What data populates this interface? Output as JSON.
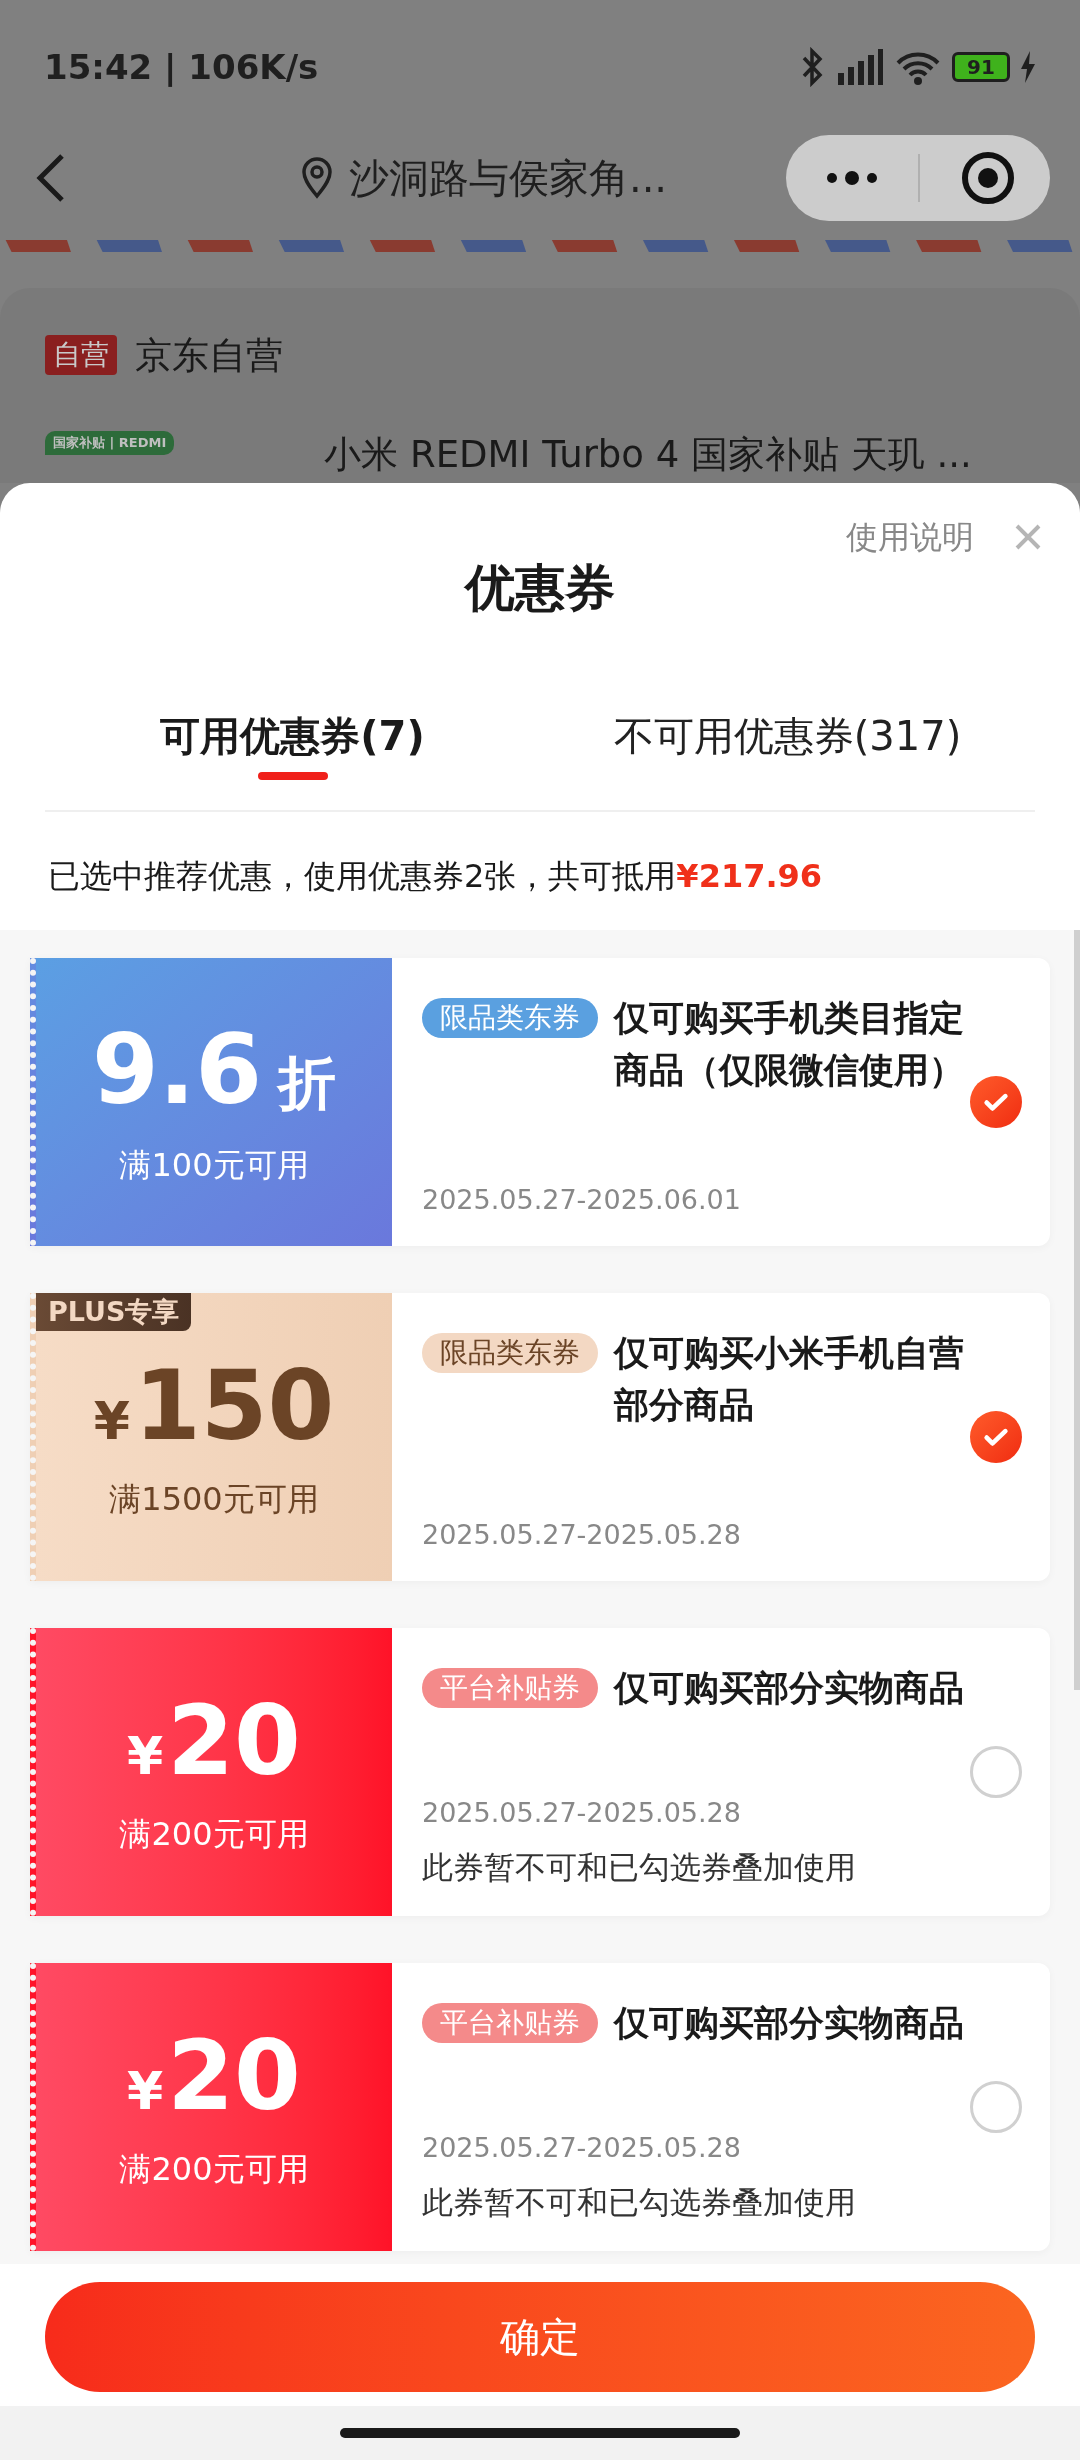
{
  "status_bar": {
    "time": "15:42 | 106K/s",
    "battery": "91"
  },
  "nav": {
    "location": "沙洞路与侯家角..."
  },
  "store": {
    "badge": "自营",
    "name": "京东自营"
  },
  "product": {
    "logo": "国家补贴 | REDMI",
    "title": "小米 REDMI Turbo 4 国家补贴 天玑 ..."
  },
  "sheet": {
    "help": "使用说明",
    "title": "优惠券"
  },
  "tabs": [
    {
      "label": "可用优惠券(7)",
      "selected": true
    },
    {
      "label": "不可用优惠券(317)",
      "selected": false
    }
  ],
  "summary": {
    "text": "已选中推荐优惠，使用优惠券2张，共可抵用",
    "amount": "¥217.96"
  },
  "coupons": [
    {
      "kind": "discount",
      "amount": "9.6",
      "unit": "折",
      "condition": "满100元可用",
      "tag": "限品类东券",
      "title": "仅可购买手机类目指定商品（仅限微信使用）",
      "date": "2025.05.27-2025.06.01",
      "selected": true
    },
    {
      "kind": "plus",
      "badge": "PLUS专享",
      "currency": "¥",
      "amount": "150",
      "condition": "满1500元可用",
      "tag": "限品类东券",
      "title": "仅可购买小米手机自营部分商品",
      "date": "2025.05.27-2025.05.28",
      "selected": true
    },
    {
      "kind": "cash",
      "currency": "¥",
      "amount": "20",
      "condition": "满200元可用",
      "tag": "平台补贴券",
      "title": "仅可购买部分实物商品",
      "date": "2025.05.27-2025.05.28",
      "note": "此券暂不可和已勾选券叠加使用",
      "selected": false
    },
    {
      "kind": "cash",
      "currency": "¥",
      "amount": "20",
      "condition": "满200元可用",
      "tag": "平台补贴券",
      "title": "仅可购买部分实物商品",
      "date": "2025.05.27-2025.05.28",
      "note": "此券暂不可和已勾选券叠加使用",
      "selected": false
    }
  ],
  "confirm": "确定"
}
